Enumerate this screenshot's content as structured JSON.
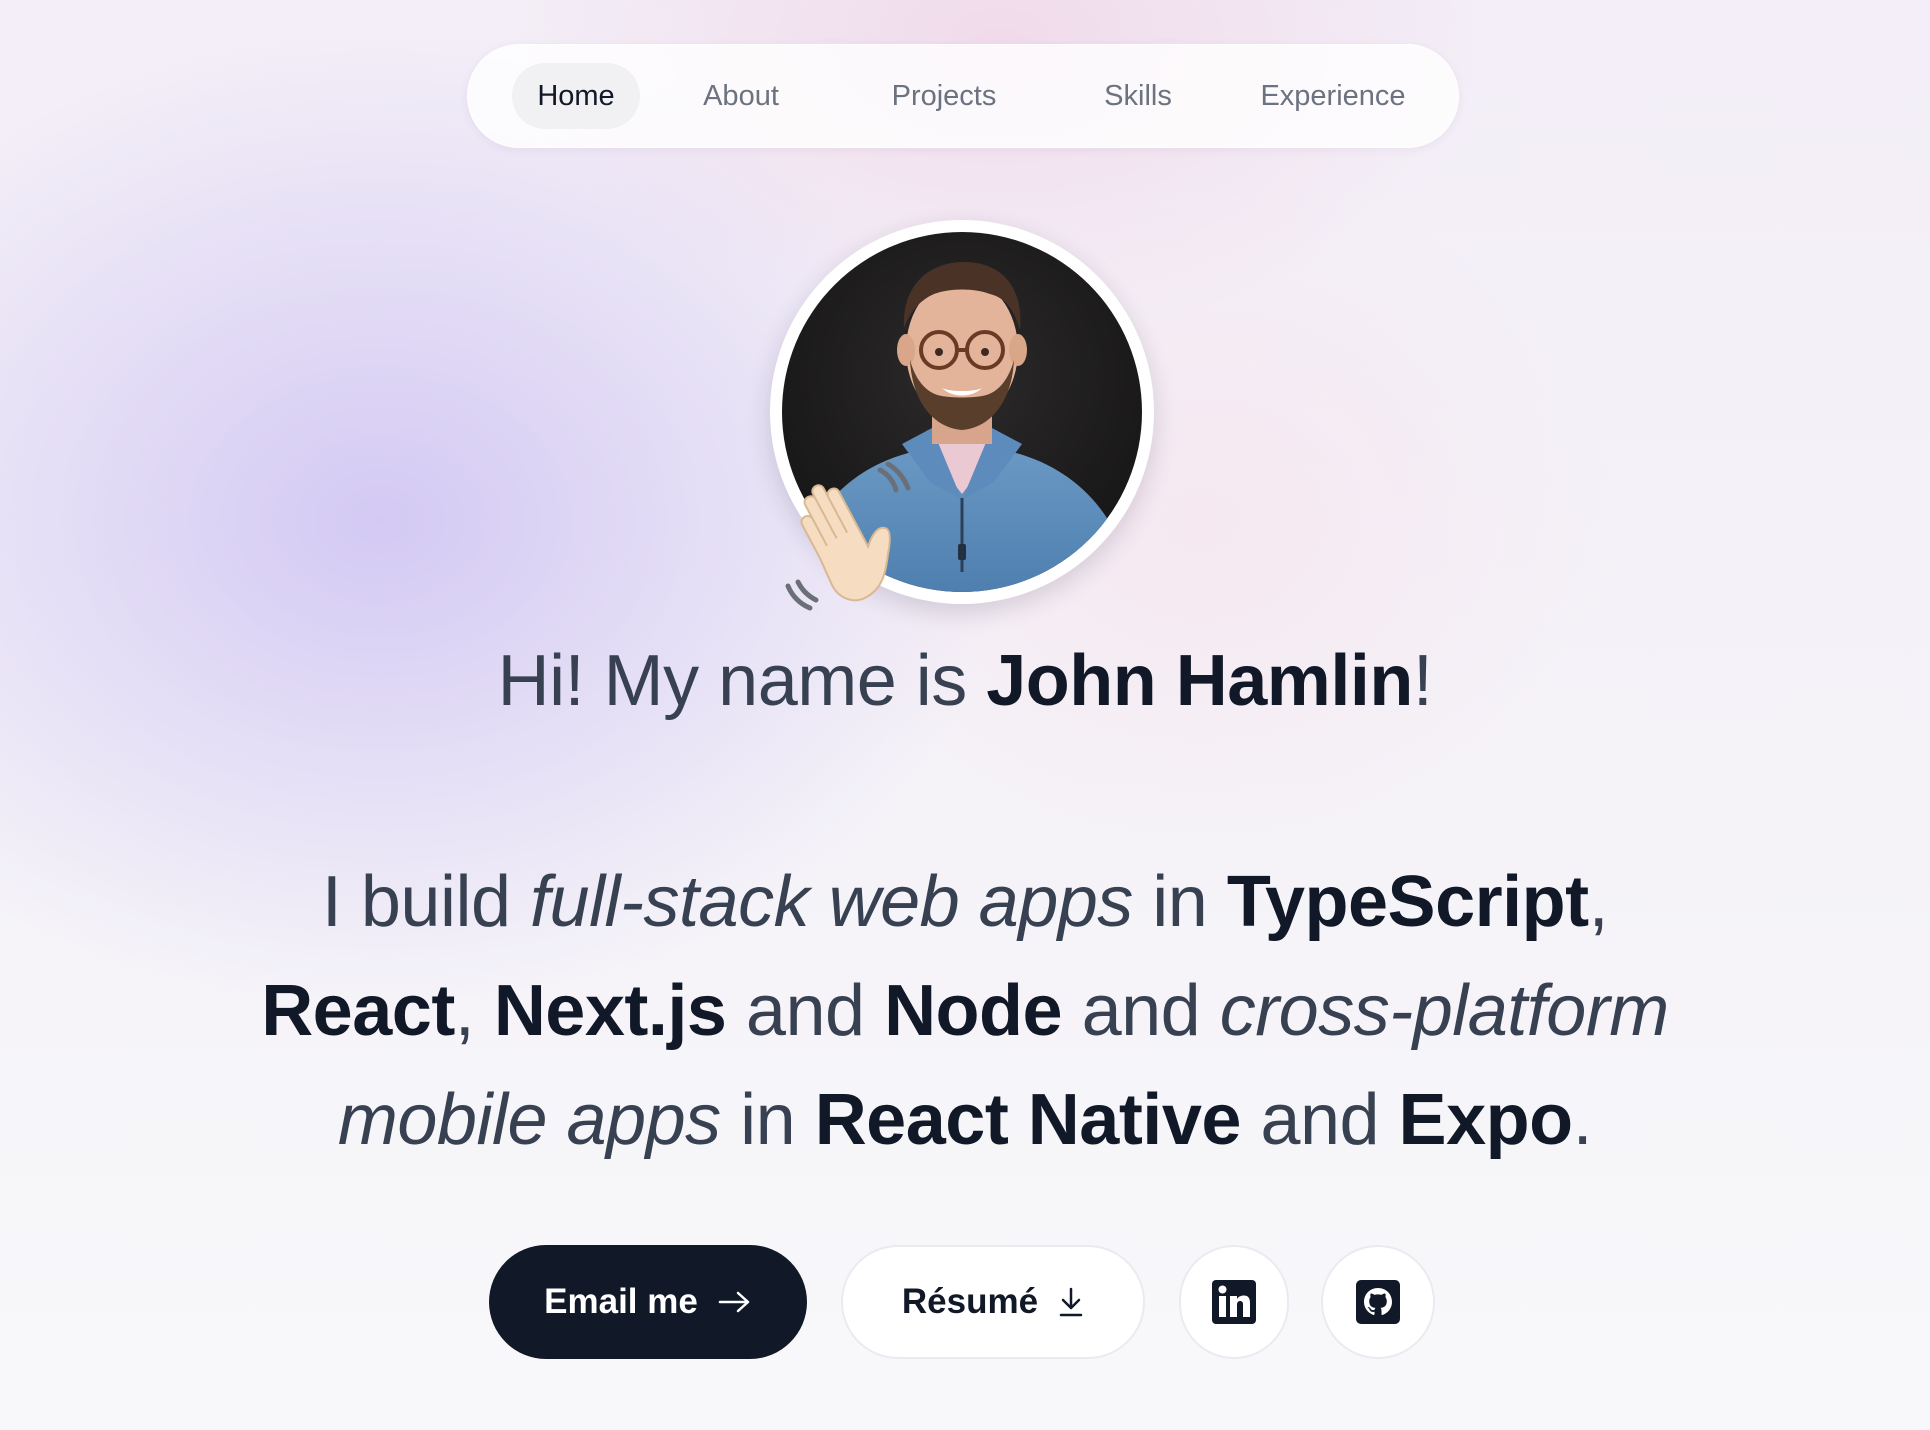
{
  "nav": {
    "items": [
      {
        "label": "Home",
        "active": true
      },
      {
        "label": "About",
        "active": false
      },
      {
        "label": "Projects",
        "active": false
      },
      {
        "label": "Skills",
        "active": false
      },
      {
        "label": "Experience",
        "active": false
      }
    ]
  },
  "hero": {
    "avatar_icon": "profile-photo",
    "wave_icon": "waving-hand-emoji",
    "greeting_prefix": "Hi! My name is ",
    "name": "John Hamlin",
    "greeting_suffix": "!",
    "tagline": {
      "t1": "I build ",
      "t2": "full-stack web apps",
      "t3": " in ",
      "t4": "TypeScript",
      "t5": ", ",
      "t6": "React",
      "t7": ", ",
      "t8": "Next.js",
      "t9": " and ",
      "t10": "Node",
      "t11": " and ",
      "t12": "cross-platform mobile apps",
      "t13": " in ",
      "t14": "React Native",
      "t15": " and ",
      "t16": "Expo",
      "t17": "."
    }
  },
  "actions": {
    "email_label": "Email me",
    "email_icon": "arrow-right-icon",
    "resume_label": "Résumé",
    "resume_icon": "download-icon",
    "linkedin_icon": "linkedin-icon",
    "github_icon": "github-icon"
  },
  "colors": {
    "primary_dark": "#111827",
    "text_muted": "#374151",
    "nav_text": "#6b7280"
  }
}
